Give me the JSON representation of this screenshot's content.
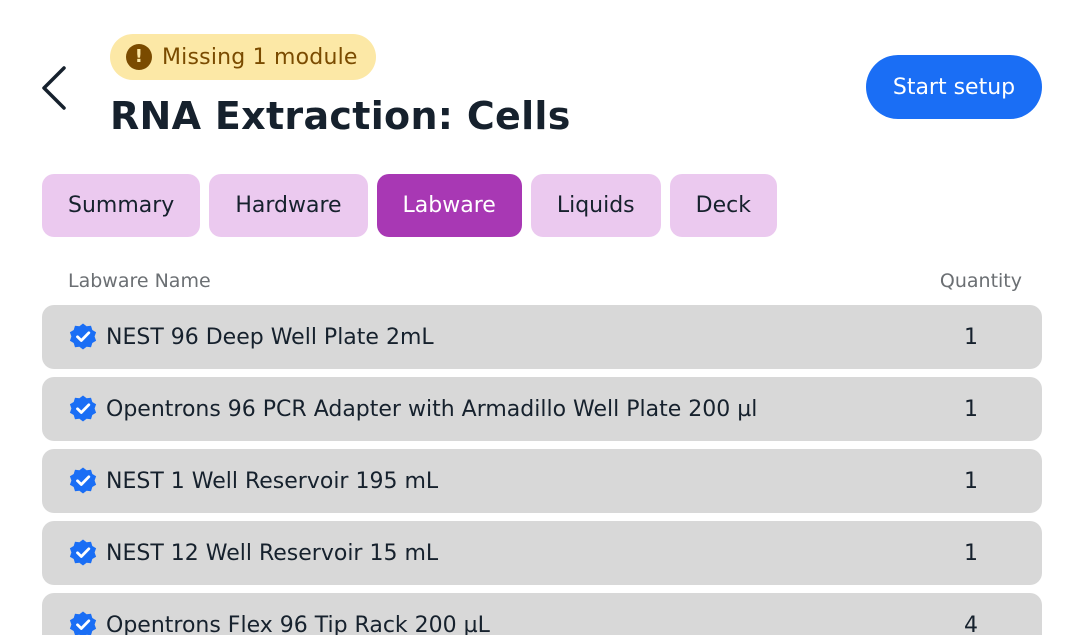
{
  "header": {
    "back_icon": "chevron-left-icon",
    "status_chip": {
      "icon": "alert-circle-icon",
      "label": "Missing 1 module"
    },
    "title": "RNA Extraction: Cells",
    "start_setup_label": "Start setup"
  },
  "tabs": [
    {
      "label": "Summary",
      "active": false
    },
    {
      "label": "Hardware",
      "active": false
    },
    {
      "label": "Labware",
      "active": true
    },
    {
      "label": "Liquids",
      "active": false
    },
    {
      "label": "Deck",
      "active": false
    }
  ],
  "table": {
    "columns": {
      "name": "Labware Name",
      "quantity": "Quantity"
    },
    "row_icon": "verified-check-icon",
    "rows": [
      {
        "name": "NEST 96 Deep Well Plate 2mL",
        "quantity": "1"
      },
      {
        "name": "Opentrons 96 PCR Adapter with Armadillo Well Plate 200 µl",
        "quantity": "1"
      },
      {
        "name": "NEST 1 Well Reservoir 195 mL",
        "quantity": "1"
      },
      {
        "name": "NEST 12 Well Reservoir 15 mL",
        "quantity": "1"
      },
      {
        "name": "Opentrons Flex 96 Tip Rack 200 µL",
        "quantity": "4"
      }
    ]
  },
  "colors": {
    "primary_blue": "#1a6ef5",
    "warning_chip_bg": "#fce8a6",
    "warning_text": "#7a4b00",
    "tab_bg": "#ebc9ef",
    "tab_active_bg": "#a838b4",
    "row_bg": "#d8d8d8",
    "text_dark": "#16212d"
  }
}
